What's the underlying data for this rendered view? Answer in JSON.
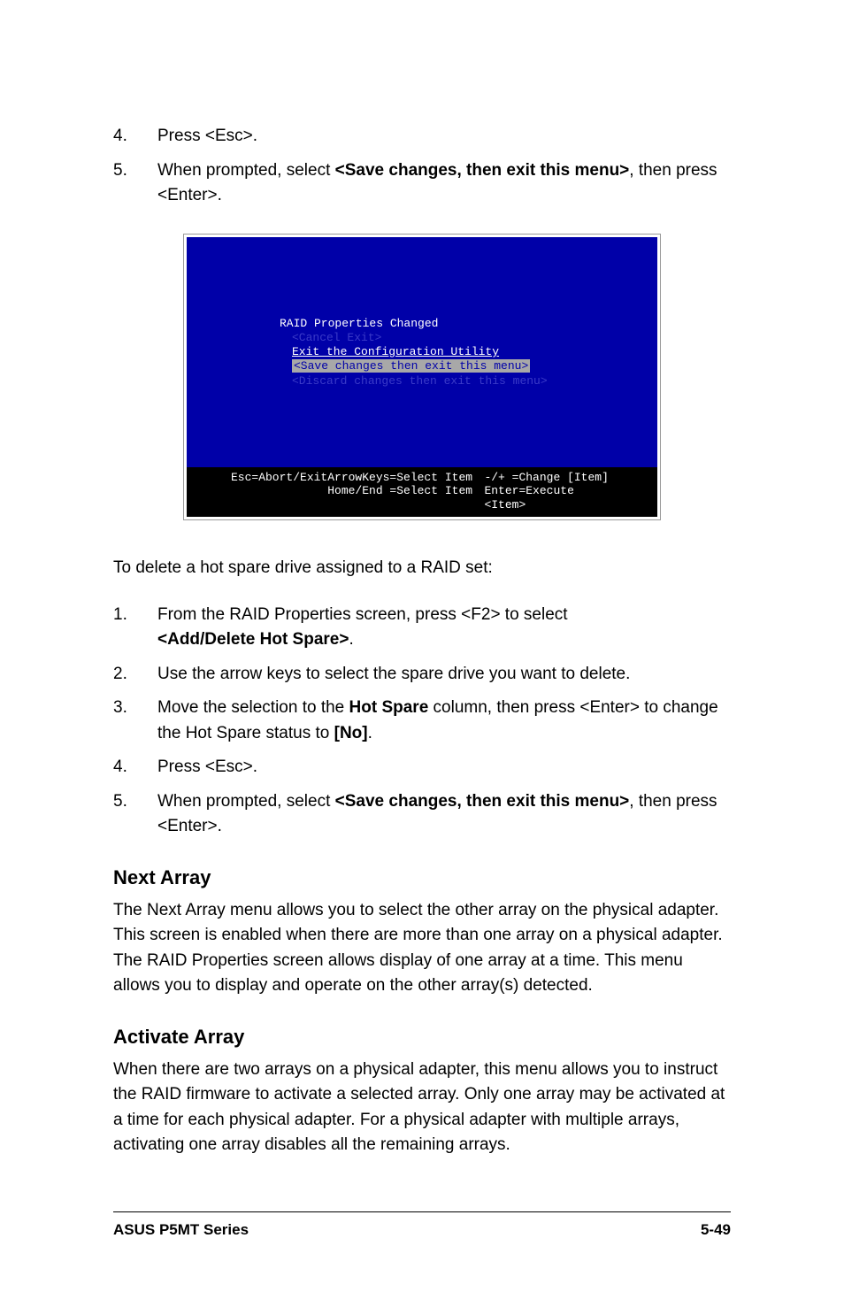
{
  "steps_top": {
    "s4": {
      "num": "4.",
      "text": "Press <Esc>."
    },
    "s5": {
      "num": "5.",
      "prefix": "When prompted, select ",
      "bold": "<Save changes, then exit this menu>",
      "suffix": ", then press <Enter>."
    }
  },
  "screenshot": {
    "title": "RAID Properties Changed",
    "opt1": "<Cancel Exit>",
    "opt2": "Exit the Configuration Utility",
    "opt3": "<Save changes then exit this menu>",
    "opt4": "<Discard changes then exit this menu>",
    "footer": {
      "esc": "Esc=Abort/Exit",
      "arrow": "ArrowKeys=Select Item",
      "home": "Home/End =Select Item",
      "change": "-/+  =Change [Item]",
      "enter": "Enter=Execute <Item>"
    }
  },
  "delete_intro": "To delete a hot spare drive assigned to a RAID set:",
  "steps_delete": {
    "s1": {
      "num": "1.",
      "prefix": "From the RAID Properties screen, press <F2> to select ",
      "bold": "<Add/Delete Hot Spare>",
      "suffix": "."
    },
    "s2": {
      "num": "2.",
      "text": "Use the arrow keys to select the spare drive you want to delete."
    },
    "s3": {
      "num": "3.",
      "p1": "Move the selection to the ",
      "b1": "Hot Spare",
      "p2": " column, then press <Enter> to change the Hot Spare status to ",
      "b2": "[No]",
      "p3": "."
    },
    "s4": {
      "num": "4.",
      "text": "Press <Esc>."
    },
    "s5": {
      "num": "5.",
      "prefix": "When prompted, select ",
      "bold": "<Save changes, then exit this menu>",
      "suffix": ", then press <Enter>."
    }
  },
  "next_array": {
    "title": "Next Array",
    "body": "The Next Array menu allows you to select the other array on the physical adapter. This screen is enabled when there are more than one array on a physical adapter. The RAID Properties screen allows display of one array at a time. This menu allows you to display and operate on the other array(s) detected."
  },
  "activate_array": {
    "title": "Activate Array",
    "body": "When there are two arrays on a physical adapter, this menu allows you to instruct the RAID firmware to activate a selected array. Only one array may be activated at a time for each physical adapter. For a physical adapter with multiple arrays, activating one array disables all the remaining arrays."
  },
  "footer": {
    "left": "ASUS P5MT Series",
    "right": "5-49"
  }
}
